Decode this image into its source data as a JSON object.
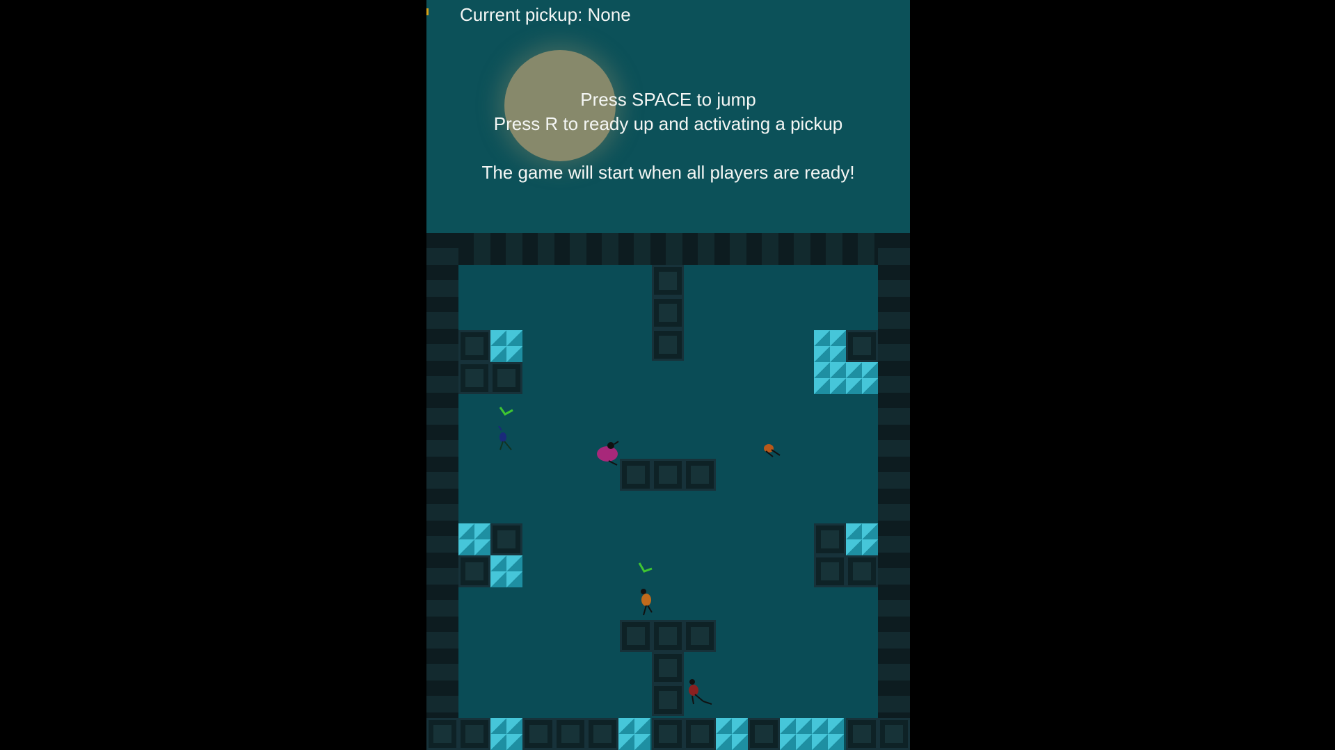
{
  "hud": {
    "pickup_text": "Current pickup: None",
    "instruction_jump": "Press SPACE to jump",
    "instruction_ready": "Press R to ready up and activating a pickup",
    "instruction_start": "The game will start when all players are ready!"
  },
  "players": [
    {
      "name": "blue-player",
      "color": "#1a2a7a",
      "ready": true
    },
    {
      "name": "magenta-player",
      "color": "#a8287a",
      "ready": false
    },
    {
      "name": "orange-player-right",
      "color": "#b8581a",
      "ready": false
    },
    {
      "name": "orange-player-center",
      "color": "#c06a1c",
      "ready": true
    },
    {
      "name": "red-player",
      "color": "#8a2020",
      "ready": false
    }
  ],
  "colors": {
    "background": "#0a4c56",
    "hud": "#0c5159",
    "accent_tile": "#46c6d9",
    "check": "#3fc531"
  }
}
